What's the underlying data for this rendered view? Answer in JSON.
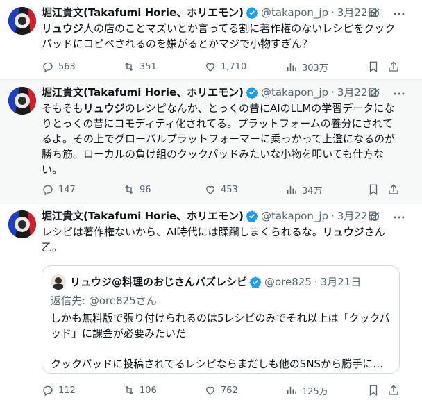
{
  "tweets": [
    {
      "name": "堀江貴文(Takafumi Horie、ホリエモン)",
      "handle": "@takapon_jp",
      "date": "3月22日",
      "text_parts": [
        {
          "b": "リュウジ"
        },
        {
          "t": "人の店のことマズいとか言ってる割に著作権のないレシピをクックパッドにコピペされるのを嫌がるとかマジで小物すぎん？"
        }
      ],
      "stats": {
        "replies": "563",
        "retweets": "351",
        "likes": "1,710",
        "views": "303万"
      }
    },
    {
      "name": "堀江貴文(Takafumi Horie、ホリエモン)",
      "handle": "@takapon_jp",
      "date": "3月22日",
      "text_parts": [
        {
          "t": "そもそも"
        },
        {
          "b": "リュウジ"
        },
        {
          "t": "のレシピなんか、とっくの昔にAIのLLMの学習データになりとっくの昔にコモディティ化されてる。プラットフォームの養分にされてるよ。その上でグローバルプラットフォーマーに乗っかって上澄になるのが勝ち筋。ローカルの負け組のクックパッドみたいな小物を叩いても仕方ない。"
        }
      ],
      "stats": {
        "replies": "147",
        "retweets": "96",
        "likes": "453",
        "views": "34万"
      }
    },
    {
      "name": "堀江貴文(Takafumi Horie、ホリエモン)",
      "handle": "@takapon_jp",
      "date": "3月22日",
      "text_parts": [
        {
          "t": "レシピは著作権ないから、AI時代には蹂躙しまくられるな。"
        },
        {
          "b": "リュウジ"
        },
        {
          "t": "さん乙。"
        }
      ],
      "stats": {
        "replies": "112",
        "retweets": "106",
        "likes": "762",
        "views": "125万"
      }
    }
  ],
  "quote": {
    "name": "リュウジ@料理のおじさんバズレシピ",
    "handle": "@ore825",
    "date": "3月21日",
    "reply_prefix": "返信先:",
    "reply_to": "@ore825さん",
    "line1": "しかも無料版で張り付けられるのは5レシピのみでそれ以上は「クックパッド」に課金が必要みたいだ",
    "line2": "クックパッドに投稿されてるレシピならまだしも他のSNSから勝手にレ..."
  },
  "colors": {
    "verified": "#1d9bf0",
    "muted": "#536471",
    "text": "#0f1419",
    "border": "#cfd9de"
  },
  "icons": [
    "verified-badge-icon",
    "grok-icon",
    "more-icon",
    "reply-icon",
    "retweet-icon",
    "like-icon",
    "views-icon",
    "bookmark-icon",
    "share-icon"
  ]
}
